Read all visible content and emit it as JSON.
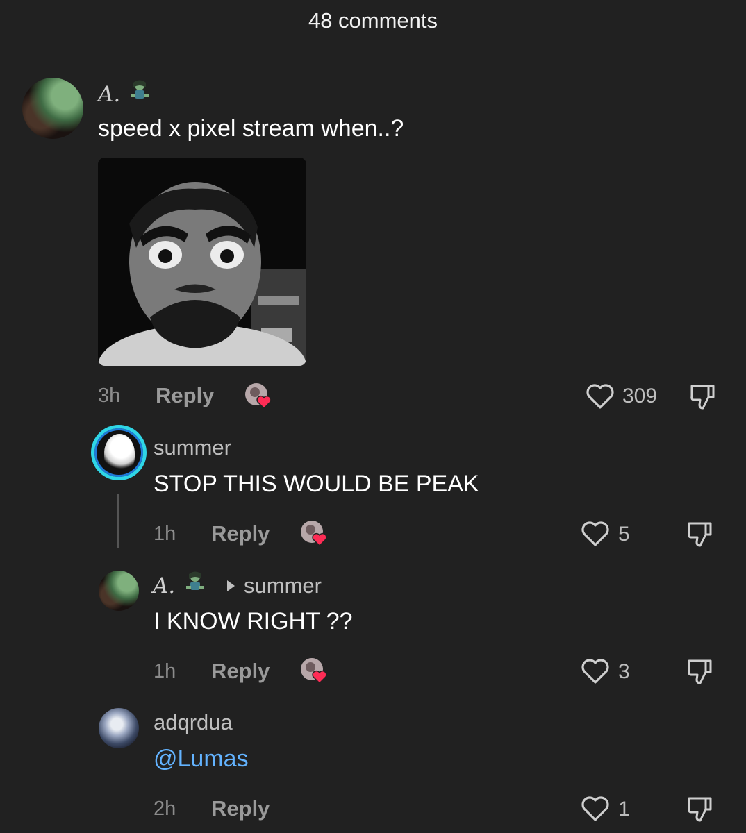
{
  "header": {
    "title": "48 comments"
  },
  "comments": [
    {
      "username": "A.",
      "text": "speed x pixel stream when..?",
      "time": "3h",
      "reply_label": "Reply",
      "likes": "309",
      "has_gif": true
    },
    {
      "username": "summer",
      "text": "STOP THIS WOULD BE PEAK",
      "time": "1h",
      "reply_label": "Reply",
      "likes": "5"
    },
    {
      "username": "A.",
      "reply_to": "summer",
      "text": "I KNOW RIGHT ??",
      "time": "1h",
      "reply_label": "Reply",
      "likes": "3"
    },
    {
      "username": "adqrdua",
      "text": "@Lumas",
      "time": "2h",
      "reply_label": "Reply",
      "likes": "1"
    }
  ],
  "colors": {
    "background": "#212121",
    "mention": "#63b3ff",
    "heart_badge": "#fe2c55",
    "avatar_ring": "#2fd6e6"
  },
  "icons": {
    "like": "heart-outline-icon",
    "dislike": "thumbs-down-icon",
    "liked_by_creator": "creator-heart-badge"
  }
}
